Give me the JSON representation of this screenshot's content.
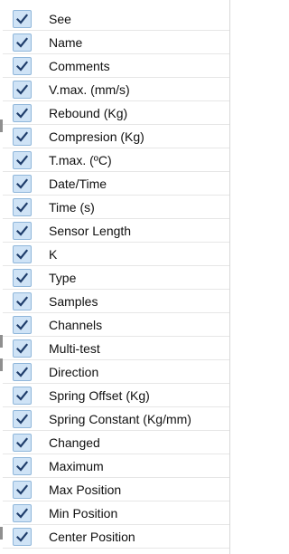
{
  "menu": {
    "check_icon": "checkmark-icon",
    "check_color": "#1f3d6b",
    "check_bg": "#cfe3f6",
    "items": [
      {
        "label": "See",
        "checked": true
      },
      {
        "label": "Name",
        "checked": true
      },
      {
        "label": "Comments",
        "checked": true
      },
      {
        "label": "V.max. (mm/s)",
        "checked": true
      },
      {
        "label": "Rebound (Kg)",
        "checked": true
      },
      {
        "label": "Compresion (Kg)",
        "checked": true
      },
      {
        "label": "T.max. (ºC)",
        "checked": true
      },
      {
        "label": "Date/Time",
        "checked": true
      },
      {
        "label": "Time (s)",
        "checked": true
      },
      {
        "label": "Sensor Length",
        "checked": true
      },
      {
        "label": "K",
        "checked": true
      },
      {
        "label": "Type",
        "checked": true
      },
      {
        "label": "Samples",
        "checked": true
      },
      {
        "label": "Channels",
        "checked": true
      },
      {
        "label": "Multi-test",
        "checked": true
      },
      {
        "label": "Direction",
        "checked": true
      },
      {
        "label": "Spring Offset (Kg)",
        "checked": true
      },
      {
        "label": "Spring Constant (Kg/mm)",
        "checked": true
      },
      {
        "label": "Changed",
        "checked": true
      },
      {
        "label": "Maximum",
        "checked": true
      },
      {
        "label": "Max Position",
        "checked": true
      },
      {
        "label": "Min Position",
        "checked": true
      },
      {
        "label": "Center Position",
        "checked": true
      }
    ]
  }
}
